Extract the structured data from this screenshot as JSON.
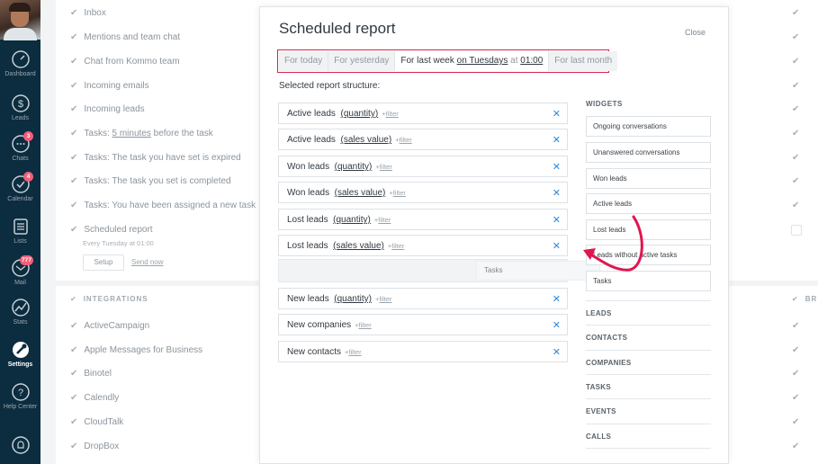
{
  "sidebar": {
    "items": [
      {
        "label": "Dashboard",
        "icon": "dashboard-icon"
      },
      {
        "label": "Leads",
        "icon": "leads-icon"
      },
      {
        "label": "Chats",
        "icon": "chats-icon",
        "badge": "3"
      },
      {
        "label": "Calendar",
        "icon": "calendar-icon",
        "badge": "4"
      },
      {
        "label": "Lists",
        "icon": "lists-icon"
      },
      {
        "label": "Mail",
        "icon": "mail-icon",
        "badge": "777"
      },
      {
        "label": "Stats",
        "icon": "stats-icon"
      },
      {
        "label": "Settings",
        "icon": "settings-icon",
        "active": true
      },
      {
        "label": "Help Center",
        "icon": "help-icon"
      },
      {
        "label": "",
        "icon": "bell-icon"
      }
    ]
  },
  "notifications": {
    "rows": [
      {
        "text": "Inbox"
      },
      {
        "text": "Mentions and team chat"
      },
      {
        "text": "Chat from Kommo team"
      },
      {
        "text": "Incoming emails"
      },
      {
        "text": "Incoming leads"
      },
      {
        "prefix": "Tasks: ",
        "link": "5 minutes",
        "suffix": " before the task"
      },
      {
        "text": "Tasks: The task you have set is expired"
      },
      {
        "text": "Tasks: The task you set is completed"
      },
      {
        "text": "Tasks: You have been assigned a new task"
      },
      {
        "text": "Scheduled report"
      }
    ],
    "scheduled_sub": "Every Tuesday at 01:00",
    "setup_label": "Setup",
    "send_now_label": "Send now"
  },
  "integrations": {
    "title": "INTEGRATIONS",
    "right_title": "BR",
    "items": [
      "ActiveCampaign",
      "Apple Messages for Business",
      "Binotel",
      "Calendly",
      "CloudTalk",
      "DropBox"
    ]
  },
  "modal": {
    "title": "Scheduled report",
    "close_label": "Close",
    "periods": {
      "today": "For today",
      "yesterday": "For yesterday",
      "last_week_prefix": "For last week ",
      "last_week_day": "on Tuesdays",
      "last_week_at": " at ",
      "last_week_time": "01:00",
      "last_month": "For last month"
    },
    "structure_label": "Selected report structure:",
    "fields": [
      {
        "name": "Active leads",
        "metric": "(quantity)",
        "filter": "filter"
      },
      {
        "name": "Active leads",
        "metric": "(sales value)",
        "filter": "filter"
      },
      {
        "name": "Won leads",
        "metric": "(quantity)",
        "filter": "filter"
      },
      {
        "name": "Won leads",
        "metric": "(sales value)",
        "filter": "filter"
      },
      {
        "name": "Lost leads",
        "metric": "(quantity)",
        "filter": "filter"
      },
      {
        "name": "Lost leads",
        "metric": "(sales value)",
        "filter": "filter"
      },
      {
        "name": "New leads",
        "metric": "(quantity)",
        "filter": "filter"
      },
      {
        "name": "New companies",
        "metric": "",
        "filter": "filter"
      },
      {
        "name": "New contacts",
        "metric": "",
        "filter": "filter"
      }
    ],
    "filter_plus": "+",
    "drag_item": "Tasks",
    "widgets_title": "WIDGETS",
    "widgets": [
      "Ongoing conversations",
      "Unanswered conversations",
      "Won leads",
      "Active leads",
      "Lost leads",
      "Leads without active tasks",
      "Tasks"
    ],
    "sections": [
      "LEADS",
      "CONTACTS",
      "COMPANIES",
      "TASKS",
      "EVENTS",
      "CALLS"
    ]
  },
  "colors": {
    "sidebar": "#0c2c3f",
    "accent_blue": "#2e8ad8",
    "highlight_red": "#d5264f",
    "arrow": "#e0164f"
  }
}
